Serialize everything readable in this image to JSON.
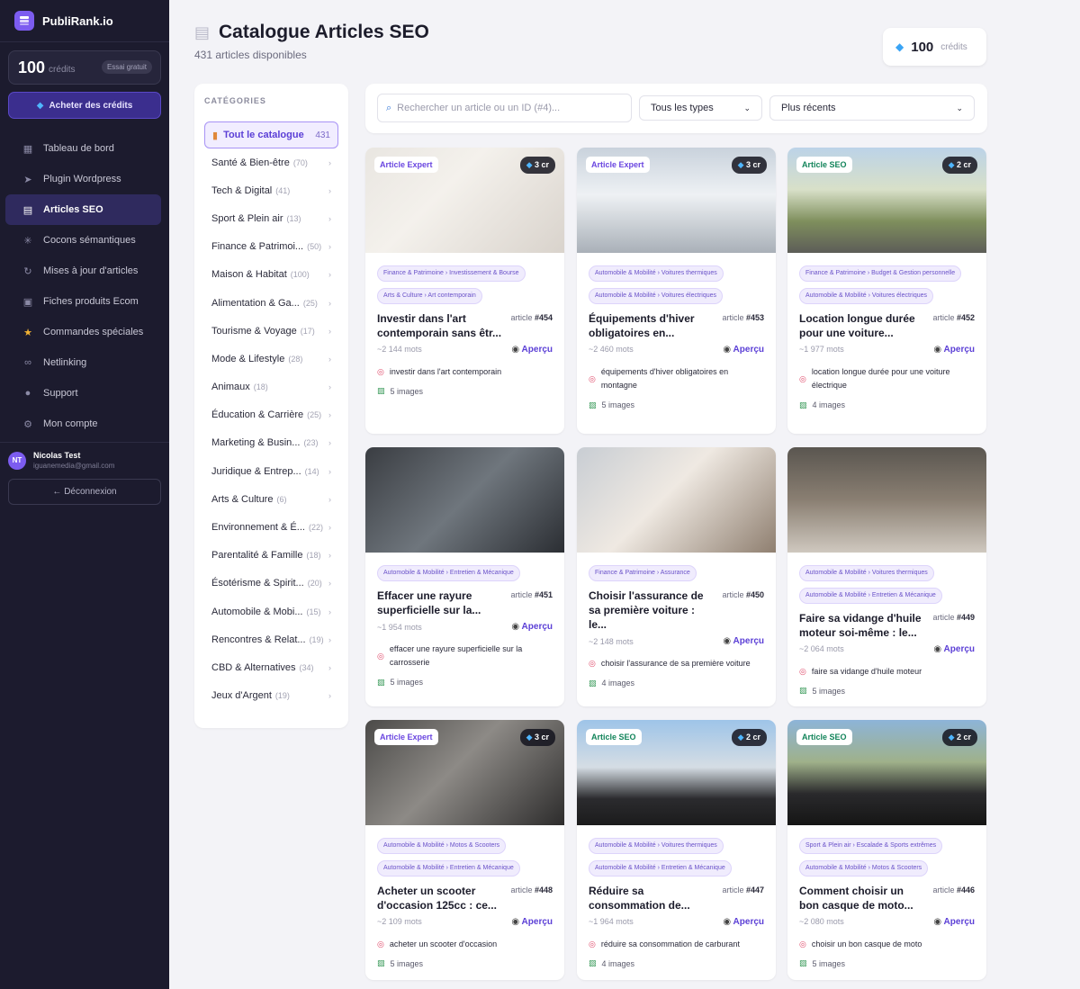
{
  "brand": {
    "name": "PubliRank.io"
  },
  "sidebar": {
    "credits": "100",
    "credits_label": "crédits",
    "trial": "Essai gratuit",
    "buy_label": "Acheter des crédits",
    "nav": [
      {
        "label": "Tableau de bord",
        "icon": "dashboard-icon"
      },
      {
        "label": "Plugin Wordpress",
        "icon": "plugin-icon"
      },
      {
        "label": "Articles SEO",
        "icon": "document-icon"
      },
      {
        "label": "Cocons sémantiques",
        "icon": "network-icon"
      },
      {
        "label": "Mises à jour d'articles",
        "icon": "refresh-icon"
      },
      {
        "label": "Fiches produits Ecom",
        "icon": "cart-icon"
      },
      {
        "label": "Commandes spéciales",
        "icon": "star-icon"
      },
      {
        "label": "Netlinking",
        "icon": "link-icon"
      },
      {
        "label": "Support",
        "icon": "chat-icon"
      },
      {
        "label": "Mon compte",
        "icon": "gear-icon"
      }
    ],
    "user": {
      "initials": "NT",
      "name": "Nicolas Test",
      "email": "iguanemedia@gmail.com"
    },
    "logout": "← Déconnexion"
  },
  "header": {
    "title": "Catalogue Articles SEO",
    "subtitle": "431 articles disponibles",
    "credits": "100",
    "credits_label": "crédits"
  },
  "categories": {
    "title": "CATÉGORIES",
    "all": {
      "label": "Tout le catalogue",
      "count": "431"
    },
    "items": [
      {
        "label": "Santé & Bien-être",
        "count": "(70)"
      },
      {
        "label": "Tech & Digital",
        "count": "(41)"
      },
      {
        "label": "Sport & Plein air",
        "count": "(13)"
      },
      {
        "label": "Finance & Patrimoi...",
        "count": "(50)"
      },
      {
        "label": "Maison & Habitat",
        "count": "(100)"
      },
      {
        "label": "Alimentation & Ga...",
        "count": "(25)"
      },
      {
        "label": "Tourisme & Voyage",
        "count": "(17)"
      },
      {
        "label": "Mode & Lifestyle",
        "count": "(28)"
      },
      {
        "label": "Animaux",
        "count": "(18)"
      },
      {
        "label": "Éducation & Carrière",
        "count": "(25)"
      },
      {
        "label": "Marketing & Busin...",
        "count": "(23)"
      },
      {
        "label": "Juridique & Entrep...",
        "count": "(14)"
      },
      {
        "label": "Arts & Culture",
        "count": "(6)"
      },
      {
        "label": "Environnement & É...",
        "count": "(22)"
      },
      {
        "label": "Parentalité & Famille",
        "count": "(18)"
      },
      {
        "label": "Ésotérisme & Spirit...",
        "count": "(20)"
      },
      {
        "label": "Automobile & Mobi...",
        "count": "(15)"
      },
      {
        "label": "Rencontres & Relat...",
        "count": "(19)"
      },
      {
        "label": "CBD & Alternatives",
        "count": "(34)"
      },
      {
        "label": "Jeux d'Argent",
        "count": "(19)"
      }
    ]
  },
  "toolbar": {
    "search_placeholder": "Rechercher un article ou un ID (#4)...",
    "type_select": "Tous les types",
    "sort_select": "Plus récents"
  },
  "colors": {
    "accent": "#5b3fd6",
    "sidebar": "#1c1b2e"
  },
  "cards": [
    {
      "badge": "Article Expert",
      "credits": "3 cr",
      "tags": [
        "Finance & Patrimoine › Investissement & Bourse",
        "Arts & Culture › Art contemporain"
      ],
      "title": "Investir dans l'art contemporain sans êtr...",
      "id_label": "article",
      "id": "#454",
      "words": "~2 144 mots",
      "preview": "Aperçu",
      "keyword": "investir dans l'art contemporain",
      "images": "5 images"
    },
    {
      "badge": "Article Expert",
      "credits": "3 cr",
      "tags": [
        "Automobile & Mobilité › Voitures thermiques",
        "Automobile & Mobilité › Voitures électriques"
      ],
      "title": "Équipements d'hiver obligatoires en...",
      "id_label": "article",
      "id": "#453",
      "words": "~2 460 mots",
      "preview": "Aperçu",
      "keyword": "équipements d'hiver obligatoires en montagne",
      "images": "5 images"
    },
    {
      "badge": "Article SEO",
      "credits": "2 cr",
      "tags": [
        "Finance & Patrimoine › Budget & Gestion personnelle",
        "Automobile & Mobilité › Voitures électriques"
      ],
      "title": "Location longue durée pour une voiture...",
      "id_label": "article",
      "id": "#452",
      "words": "~1 977 mots",
      "preview": "Aperçu",
      "keyword": "location longue durée pour une voiture électrique",
      "images": "4 images"
    },
    {
      "badge": "",
      "credits": "",
      "tags": [
        "Automobile & Mobilité › Entretien & Mécanique"
      ],
      "title": "Effacer une rayure superficielle sur la...",
      "id_label": "article",
      "id": "#451",
      "words": "~1 954 mots",
      "preview": "Aperçu",
      "keyword": "effacer une rayure superficielle sur la carrosserie",
      "images": "5 images"
    },
    {
      "badge": "",
      "credits": "",
      "tags": [
        "Finance & Patrimoine › Assurance"
      ],
      "title": "Choisir l'assurance de sa première voiture : le...",
      "id_label": "article",
      "id": "#450",
      "words": "~2 148 mots",
      "preview": "Aperçu",
      "keyword": "choisir l'assurance de sa première voiture",
      "images": "4 images"
    },
    {
      "badge": "",
      "credits": "",
      "tags": [
        "Automobile & Mobilité › Voitures thermiques",
        "Automobile & Mobilité › Entretien & Mécanique"
      ],
      "title": "Faire sa vidange d'huile moteur soi-même : le...",
      "id_label": "article",
      "id": "#449",
      "words": "~2 064 mots",
      "preview": "Aperçu",
      "keyword": "faire sa vidange d'huile moteur",
      "images": "5 images"
    },
    {
      "badge": "Article Expert",
      "credits": "3 cr",
      "tags": [
        "Automobile & Mobilité › Motos & Scooters",
        "Automobile & Mobilité › Entretien & Mécanique"
      ],
      "title": "Acheter un scooter d'occasion 125cc : ce...",
      "id_label": "article",
      "id": "#448",
      "words": "~2 109 mots",
      "preview": "Aperçu",
      "keyword": "acheter un scooter d'occasion",
      "images": "5 images"
    },
    {
      "badge": "Article SEO",
      "credits": "2 cr",
      "tags": [
        "Automobile & Mobilité › Voitures thermiques",
        "Automobile & Mobilité › Entretien & Mécanique"
      ],
      "title": "Réduire sa consommation de...",
      "id_label": "article",
      "id": "#447",
      "words": "~1 964 mots",
      "preview": "Aperçu",
      "keyword": "réduire sa consommation de carburant",
      "images": "4 images"
    },
    {
      "badge": "Article SEO",
      "credits": "2 cr",
      "tags": [
        "Sport & Plein air › Escalade & Sports extrêmes",
        "Automobile & Mobilité › Motos & Scooters"
      ],
      "title": "Comment choisir un bon casque de moto...",
      "id_label": "article",
      "id": "#446",
      "words": "~2 080 mots",
      "preview": "Aperçu",
      "keyword": "choisir un bon casque de moto",
      "images": "5 images"
    }
  ]
}
